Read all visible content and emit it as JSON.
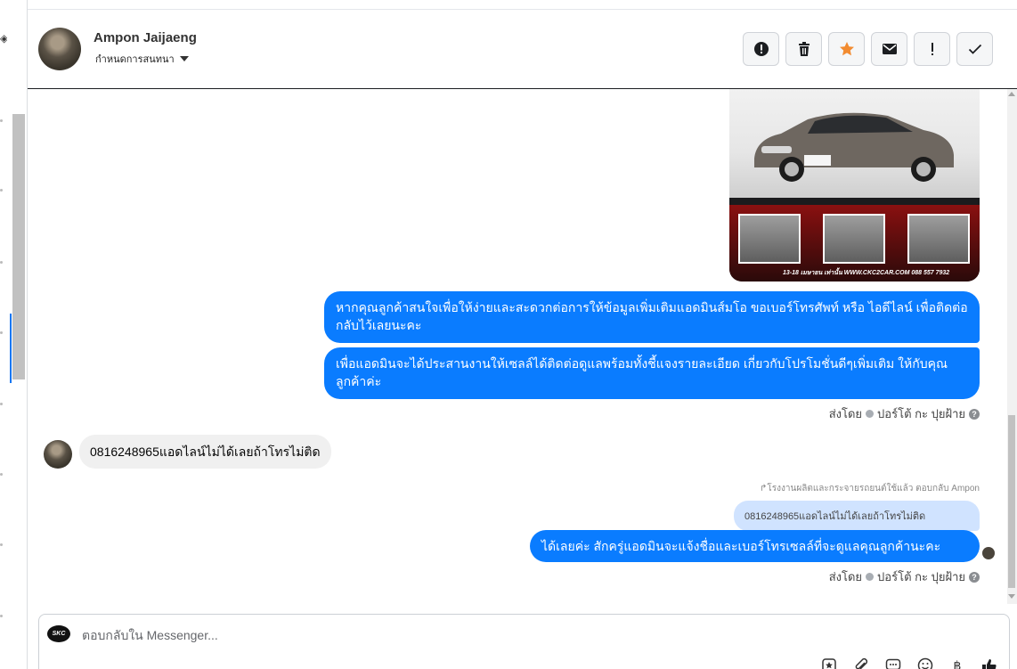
{
  "contact": {
    "name": "Ampon Jaijaeng",
    "subtitle": "กำหนดการสนทนา"
  },
  "actions": [
    {
      "icon": "alert-circle-icon"
    },
    {
      "icon": "trash-icon"
    },
    {
      "icon": "star-icon",
      "color": "#f28b30"
    },
    {
      "icon": "envelope-icon"
    },
    {
      "icon": "exclamation-icon"
    },
    {
      "icon": "check-icon"
    }
  ],
  "car_image": {
    "footer": "13-18 เมษายน เท่านั้น   WWW.CKC2CAR.COM 088 557 7932"
  },
  "messages": {
    "out1": "หากคุณลูกค้าสนใจเพื่อให้ง่ายและสะดวกต่อการให้ข้อมูลเพิ่มเติมแอดมินส์มโอ ขอเบอร์โทรศัพท์ หรือ ไอดีไลน์ เพื่อติดต่อกลับไว้เลยนะคะ",
    "out2": "เพื่อแอดมินจะได้ประสานงานให้เซลล์ได้ติดต่อดูแลพร้อมทั้งชี้แจงรายละเอียด เกี่ยวกับโปรโมชั่นดีๆเพิ่มเติม ให้กับคุณลูกค้าค่ะ",
    "sent_by_prefix": "ส่งโดย",
    "sent_by_name": "ปอร์โต้ กะ ปุยฝ้าย",
    "in1": "0816248965แอดไลน์ไม่ได้เลยถ้าโทรไม่ติด",
    "reply_note": "↱โรงงานผลิตและกระจายรถยนต์ใช้แล้ว ตอบกลับ Ampon",
    "quoted": "0816248965แอดไลน์ไม่ได้เลยถ้าโทรไม่ติด",
    "out3": "ได้เลยค่ะ สักครู่แอดมินจะแจ้งชื่อและเบอร์โทรเซลล์ที่จะดูแลคุณลูกค้านะคะ"
  },
  "composer": {
    "placeholder": "ตอบกลับใน Messenger...",
    "page_logo": "SKC",
    "tools": [
      "sticker-icon",
      "paperclip-icon",
      "chat-bubble-icon",
      "emoji-icon",
      "baht-icon",
      "thumbs-up-icon"
    ]
  },
  "colors": {
    "bubble_out": "#0a7cff",
    "bubble_in": "#f0f0f0",
    "quoted_bg": "#d0e3ff"
  }
}
